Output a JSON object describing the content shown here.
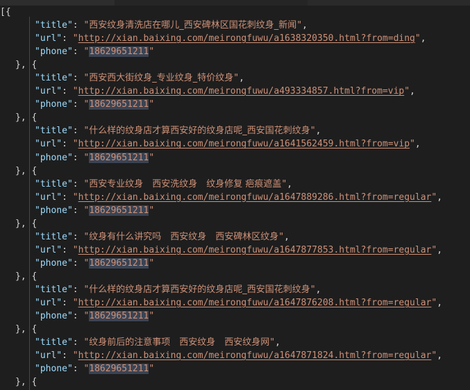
{
  "window": {
    "theme_background": "#1e1e1e",
    "tabbar_background": "#252526",
    "accent_key_color": "#9cdcfe",
    "accent_string_color": "#ce9178",
    "punctuation_color": "#d4d4d4",
    "selection_highlight_color": "#3a4454"
  },
  "tabs": [
    {
      "label": ""
    },
    {
      "label": ""
    },
    {
      "label": ""
    }
  ],
  "document": {
    "open_bracket": "[{",
    "separator": "}, {",
    "keys": {
      "title": "\"title\"",
      "url": "\"url\"",
      "phone": "\"phone\""
    },
    "colon": ": ",
    "comma": ",",
    "quote": "\"",
    "records": [
      {
        "title": "西安纹身清洗店在哪儿_西安碑林区国花刺纹身_新闻",
        "url": "http://xian.baixing.com/meirongfuwu/a1638320350.html?from=ding",
        "phone": "18629651211"
      },
      {
        "title": "西安西大街纹身_专业纹身_特价纹身",
        "url": "http://xian.baixing.com/meirongfuwu/a493334857.html?from=vip",
        "phone": "18629651211"
      },
      {
        "title": "什么样的纹身店才算西安好的纹身店呢_西安国花刺纹身",
        "url": "http://xian.baixing.com/meirongfuwu/a1641562459.html?from=vip",
        "phone": "18629651211"
      },
      {
        "title": "西安专业纹身　西安洗纹身　纹身修复 疤痕遮盖",
        "url": "http://xian.baixing.com/meirongfuwu/a1647889286.html?from=regular",
        "phone": "18629651211"
      },
      {
        "title": "纹身有什么讲究吗　西安纹身　西安碑林区纹身",
        "url": "http://xian.baixing.com/meirongfuwu/a1647877853.html?from=regular",
        "phone": "18629651211"
      },
      {
        "title": "什么样的纹身店才算西安好的纹身店呢_西安国花刺纹身",
        "url": "http://xian.baixing.com/meirongfuwu/a1647876208.html?from=regular",
        "phone": "18629651211"
      },
      {
        "title": "纹身前后的注意事项　西安纹身　西安纹身网",
        "url": "http://xian.baixing.com/meirongfuwu/a1647871824.html?from=regular",
        "phone": "18629651211"
      }
    ]
  }
}
